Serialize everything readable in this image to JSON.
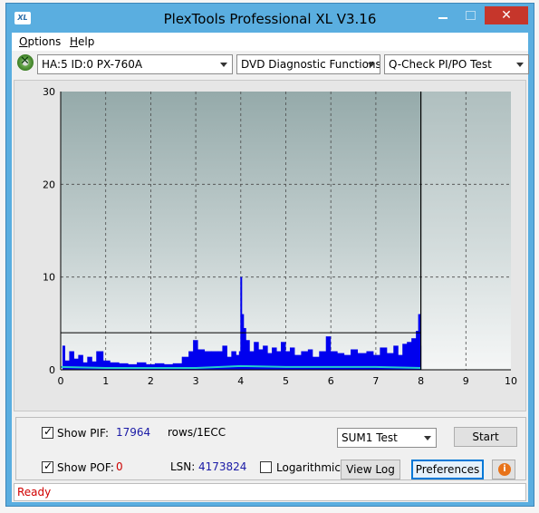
{
  "window": {
    "title": "PlexTools Professional XL V3.16",
    "icon_label": "XL",
    "close_glyph": "✕"
  },
  "menu": {
    "items": [
      {
        "label": "Options",
        "underline": "O",
        "rest": "ptions"
      },
      {
        "label": "Help",
        "underline": "H",
        "rest": "elp"
      }
    ]
  },
  "toolbar": {
    "drive": "HA:5 ID:0  PX-760A",
    "function": "DVD Diagnostic Functions",
    "test": "Q-Check PI/PO Test"
  },
  "chart_data": {
    "type": "bar",
    "xlim": [
      0,
      10
    ],
    "ylim": [
      0,
      30
    ],
    "x_ticks": [
      "0",
      "1",
      "2",
      "3",
      "4",
      "5",
      "6",
      "7",
      "8",
      "9",
      "10"
    ],
    "y_ticks": [
      "0",
      "10",
      "20",
      "30"
    ],
    "grid": true,
    "threshold_line": 4,
    "end_marker_x": 8,
    "data_end_x": 8,
    "series": [
      {
        "color": "#0000ee",
        "points": [
          [
            0.05,
            2.6
          ],
          [
            0.1,
            1.0
          ],
          [
            0.2,
            2.0
          ],
          [
            0.3,
            1.2
          ],
          [
            0.4,
            1.6
          ],
          [
            0.5,
            0.8
          ],
          [
            0.6,
            1.4
          ],
          [
            0.7,
            0.9
          ],
          [
            0.8,
            2.0
          ],
          [
            0.95,
            1.0
          ],
          [
            1.1,
            0.8
          ],
          [
            1.3,
            0.7
          ],
          [
            1.5,
            0.6
          ],
          [
            1.7,
            0.8
          ],
          [
            1.9,
            0.6
          ],
          [
            2.1,
            0.7
          ],
          [
            2.3,
            0.6
          ],
          [
            2.5,
            0.7
          ],
          [
            2.7,
            1.4
          ],
          [
            2.85,
            2.0
          ],
          [
            2.95,
            3.2
          ],
          [
            3.05,
            2.2
          ],
          [
            3.2,
            2.0
          ],
          [
            3.35,
            2.0
          ],
          [
            3.5,
            2.0
          ],
          [
            3.6,
            2.6
          ],
          [
            3.7,
            1.4
          ],
          [
            3.8,
            2.0
          ],
          [
            3.9,
            1.6
          ],
          [
            3.97,
            2.0
          ],
          [
            4.0,
            10.0
          ],
          [
            4.03,
            6.0
          ],
          [
            4.07,
            4.5
          ],
          [
            4.12,
            3.2
          ],
          [
            4.2,
            2.0
          ],
          [
            4.3,
            3.0
          ],
          [
            4.4,
            2.2
          ],
          [
            4.5,
            2.6
          ],
          [
            4.6,
            1.8
          ],
          [
            4.7,
            2.4
          ],
          [
            4.8,
            2.0
          ],
          [
            4.9,
            3.0
          ],
          [
            5.0,
            2.0
          ],
          [
            5.1,
            2.4
          ],
          [
            5.2,
            1.6
          ],
          [
            5.35,
            2.0
          ],
          [
            5.5,
            2.2
          ],
          [
            5.6,
            1.4
          ],
          [
            5.75,
            2.0
          ],
          [
            5.9,
            3.6
          ],
          [
            6.0,
            2.0
          ],
          [
            6.15,
            1.8
          ],
          [
            6.3,
            1.6
          ],
          [
            6.45,
            2.2
          ],
          [
            6.6,
            1.8
          ],
          [
            6.8,
            2.0
          ],
          [
            6.95,
            1.6
          ],
          [
            7.1,
            2.4
          ],
          [
            7.25,
            1.8
          ],
          [
            7.4,
            2.6
          ],
          [
            7.5,
            1.6
          ],
          [
            7.6,
            2.8
          ],
          [
            7.7,
            3.0
          ],
          [
            7.8,
            3.4
          ],
          [
            7.9,
            4.2
          ],
          [
            7.95,
            6.0
          ],
          [
            7.99,
            2.6
          ]
        ]
      },
      {
        "color": "#22cccc",
        "points": [
          [
            0.0,
            0.3
          ],
          [
            1.0,
            0.2
          ],
          [
            2.0,
            0.2
          ],
          [
            3.0,
            0.2
          ],
          [
            4.0,
            0.4
          ],
          [
            5.0,
            0.3
          ],
          [
            6.0,
            0.3
          ],
          [
            7.0,
            0.3
          ],
          [
            8.0,
            0.2
          ]
        ]
      }
    ]
  },
  "controls": {
    "show_pif_label": "Show PIF:",
    "pif_value": "17964",
    "pif_unit": "rows/1ECC",
    "show_pof_label": "Show POF:",
    "pof_value": "0",
    "lsn_label": "LSN:",
    "lsn_value": "4173824",
    "logarithmic_label": "Logarithmic",
    "test_select": "SUM1 Test",
    "start_label": "Start",
    "view_log_label": "View Log",
    "preferences_label": "Preferences",
    "info_glyph": "i",
    "show_pif_checked": true,
    "show_pof_checked": true,
    "logarithmic_checked": false
  },
  "statusbar": {
    "text": "Ready"
  }
}
